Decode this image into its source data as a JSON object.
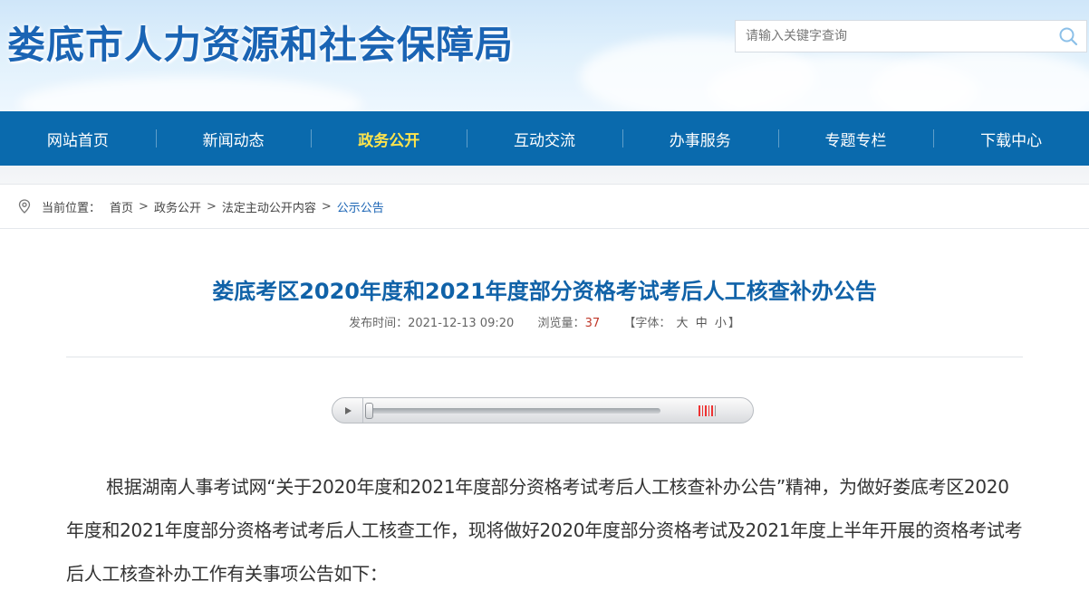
{
  "site": {
    "title": "娄底市人力资源和社会保障局"
  },
  "search": {
    "placeholder": "请输入关键字查询"
  },
  "nav": {
    "items": [
      {
        "label": "网站首页"
      },
      {
        "label": "新闻动态"
      },
      {
        "label": "政务公开"
      },
      {
        "label": "互动交流"
      },
      {
        "label": "办事服务"
      },
      {
        "label": "专题专栏"
      },
      {
        "label": "下载中心"
      }
    ],
    "active_index": 2
  },
  "breadcrumb": {
    "prefix": "当前位置：",
    "items": [
      "首页",
      "政务公开",
      "法定主动公开内容",
      "公示公告"
    ],
    "separator": ">"
  },
  "article": {
    "title": "娄底考区2020年度和2021年度部分资格考试考后人工核查补办公告",
    "publish_label": "发布时间：",
    "publish_time": "2021-12-13 09:20",
    "views_label": "浏览量：",
    "views": "37",
    "font_label": "【字体：",
    "font_large": "大",
    "font_medium": "中",
    "font_small": "小",
    "font_close": "】",
    "body": "根据湖南人事考试网“关于2020年度和2021年度部分资格考试考后人工核查补办公告”精神，为做好娄底考区2020年度和2021年度部分资格考试考后人工核查工作，现将做好2020年度部分资格考试及2021年度上半年开展的资格考试考后人工核查补办工作有关事项公告如下："
  },
  "player": {
    "progress": 0,
    "volume_bars_total": 6,
    "volume_bars_on": 5
  },
  "colors": {
    "brand_blue": "#1a64b4",
    "nav_bg": "#0a6aad",
    "nav_active": "#ffe44d",
    "title_blue": "#1062a8",
    "views_red": "#c0392b"
  },
  "icons": {
    "search": "search-icon",
    "location": "location-pin-icon",
    "play": "play-icon"
  }
}
